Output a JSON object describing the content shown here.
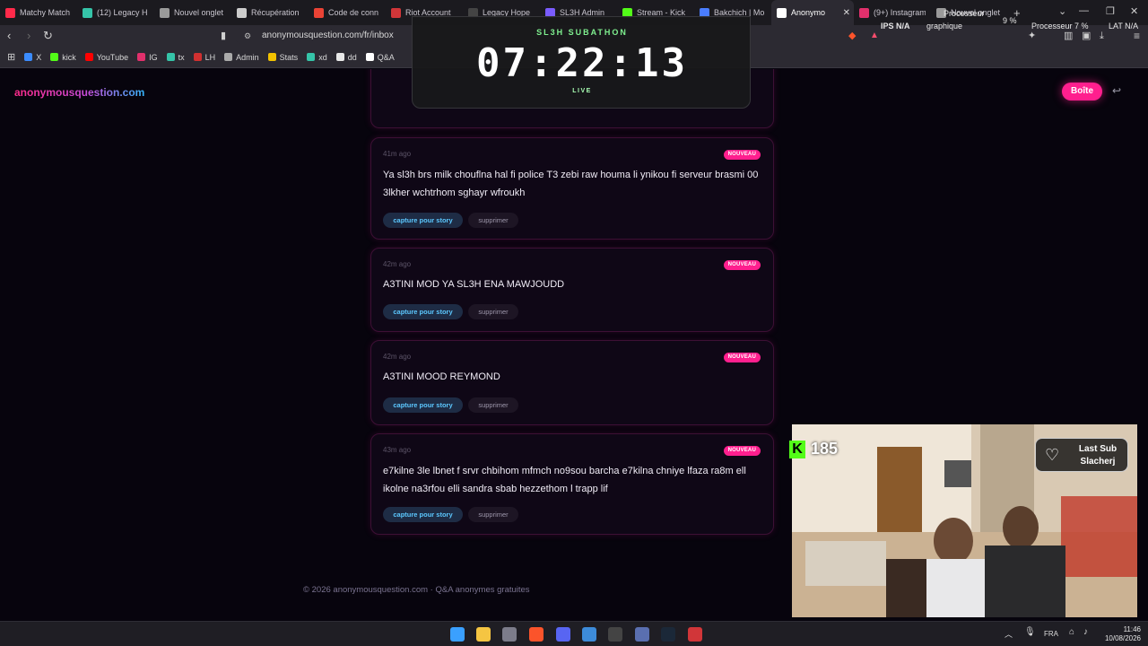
{
  "browser": {
    "tabs": [
      {
        "label": "Matchy Match",
        "color": "#ff2a4a"
      },
      {
        "label": "(12) Legacy H",
        "color": "#35c4a8"
      },
      {
        "label": "Nouvel onglet",
        "color": "#9a9a9a"
      },
      {
        "label": "Récupération",
        "color": "#cccccc"
      },
      {
        "label": "Code de conn",
        "color": "#ea4335"
      },
      {
        "label": "Riot Account",
        "color": "#d13639"
      },
      {
        "label": "Legacy Hope",
        "color": "#444444"
      },
      {
        "label": "SL3H Admin",
        "color": "#7a5cff"
      },
      {
        "label": "Stream - Kick",
        "color": "#53fc18"
      },
      {
        "label": "Bakchich | Mo",
        "color": "#4a7dff"
      },
      {
        "label": "Anonymo",
        "color": "#ffffff",
        "active": true
      },
      {
        "label": "(9+) Instagram",
        "color": "#e1306c"
      },
      {
        "label": "Nouvel onglet",
        "color": "#9a9a9a"
      }
    ],
    "url": "anonymousquestion.com/fr/inbox",
    "bookmarks": [
      {
        "label": "X",
        "color": "#3b8cff"
      },
      {
        "label": "kick",
        "color": "#53fc18"
      },
      {
        "label": "YouTube",
        "color": "#ff0000"
      },
      {
        "label": "IG",
        "color": "#e1306c"
      },
      {
        "label": "tx",
        "color": "#35c4a8"
      },
      {
        "label": "LH",
        "color": "#d03030"
      },
      {
        "label": "Admin",
        "color": "#aaaaaa"
      },
      {
        "label": "Stats",
        "color": "#f2c200"
      },
      {
        "label": "xd",
        "color": "#35c4a8"
      },
      {
        "label": "dd",
        "color": "#e8e8e8"
      },
      {
        "label": "Q&A",
        "color": "#ffffff"
      }
    ]
  },
  "site": {
    "logo": "anonymousquestion.com",
    "inbox_button": "Boîte",
    "footer": "© 2026 anonymousquestion.com · Q&A anonymes gratuites"
  },
  "questions": [
    {
      "time": "41m ago",
      "badge": "NOUVEAU",
      "text": "Ya sl3h  brs milk chouflna hal fi police T3 zebi raw houma li ynikou fi serveur brasmi 00 3lkher wchtrhom sghayr wfroukh",
      "story_label": "capture pour story",
      "delete_label": "supprimer"
    },
    {
      "time": "42m ago",
      "badge": "NOUVEAU",
      "text": "A3TINI MOD YA SL3H ENA MAWJOUDD",
      "story_label": "capture pour story",
      "delete_label": "supprimer"
    },
    {
      "time": "42m ago",
      "badge": "NOUVEAU",
      "text": "A3TINI MOOD REYMOND",
      "story_label": "capture pour story",
      "delete_label": "supprimer"
    },
    {
      "time": "43m ago",
      "badge": "NOUVEAU",
      "text": "e7kilne 3le lbnet f srvr chbihom mfmch no9sou barcha e7kilna chniye lfaza ra8m ell ikolne na3rfou elli sandra sbab hezzethom l trapp lif",
      "story_label": "capture pour story",
      "delete_label": "supprimer"
    }
  ],
  "stream": {
    "subathon_title": "SL3H SUBATHON",
    "timer": "07:22:13",
    "live": "LIVE",
    "kick_count": "185",
    "last_sub_title": "Last Sub",
    "last_sub_name": "Slacherj",
    "perf_line1": "Processeur",
    "perf_cpu": "9 %",
    "perf_fps": "IPS  N/A",
    "perf_gpu_label": "graphique",
    "perf_cpu2": "Processeur  7 %",
    "perf_lat": "LAT  N/A"
  },
  "taskbar": {
    "lang": "FRA",
    "time": "11:46",
    "date": "10/08/2026"
  }
}
